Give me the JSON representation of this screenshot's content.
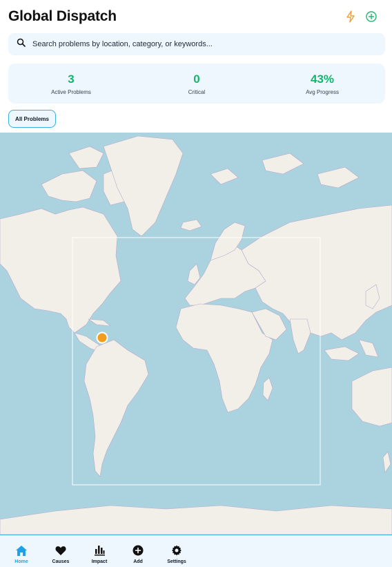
{
  "header": {
    "title": "Global Dispatch",
    "icons": [
      "lightning-icon",
      "add-circle-icon"
    ]
  },
  "search": {
    "placeholder": "Search problems by location, category, or keywords..."
  },
  "stats": [
    {
      "value": "3",
      "label": "Active Problems"
    },
    {
      "value": "0",
      "label": "Critical"
    },
    {
      "value": "43%",
      "label": "Avg Progress"
    }
  ],
  "filter": {
    "label": "All Problems"
  },
  "map": {
    "markers": [
      {
        "status": "active",
        "color": "#f29d1b"
      }
    ]
  },
  "nav": {
    "items": [
      {
        "label": "Home",
        "icon": "home-icon",
        "active": true
      },
      {
        "label": "Causes",
        "icon": "heart-icon",
        "active": false
      },
      {
        "label": "Impact",
        "icon": "bar-chart-icon",
        "active": false
      },
      {
        "label": "Add",
        "icon": "add-icon",
        "active": false
      },
      {
        "label": "Settings",
        "icon": "gear-icon",
        "active": false
      }
    ]
  },
  "colors": {
    "accent": "#16b36a",
    "nav_active": "#1ea1e6",
    "lightning": "#e9a23b",
    "add": "#22b573",
    "ocean": "#aad3df",
    "land": "#f2efe9",
    "marker": "#f29d1b"
  }
}
